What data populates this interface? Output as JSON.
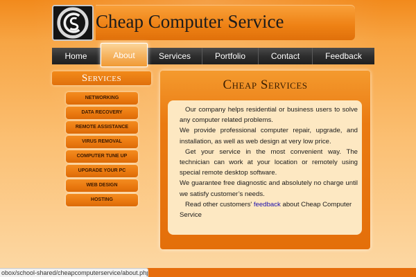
{
  "header": {
    "site_title": "Cheap Computer Service",
    "logo_text": "CS"
  },
  "nav": {
    "items": [
      {
        "label": "Home"
      },
      {
        "label": "About"
      },
      {
        "label": "Services"
      },
      {
        "label": "Portfolio"
      },
      {
        "label": "Contact"
      },
      {
        "label": "Feedback"
      }
    ],
    "active": "About"
  },
  "sidebar": {
    "title": "Services",
    "items": [
      {
        "label": "NETWORKING"
      },
      {
        "label": "DATA RECOVERY"
      },
      {
        "label": "REMOTE ASSISTANCE"
      },
      {
        "label": "VIRUS REMOVAL"
      },
      {
        "label": "COMPUTER TUNE UP"
      },
      {
        "label": "UPGRADE YOUR PC"
      },
      {
        "label": "WEB DESIGN"
      },
      {
        "label": "HOSTING"
      }
    ]
  },
  "main": {
    "title": "Cheap Services",
    "paragraphs": [
      "Our company helps residential or business users to solve any computer related problems.",
      "We provide professional computer repair, upgrade, and installation, as well as web design at very low price.",
      "Get your service in the most convenient way. The technician can work at your location or remotely using special remote desktop software.",
      "We guarantee free diagnostic and absolutely no charge until we satisfy customer’s needs."
    ],
    "last_paragraph": {
      "before": "Read other customers'",
      "link": "feedback",
      "after": "about Cheap Computer Service"
    }
  },
  "status_bar": {
    "url": "obox/school-shared/cheapcomputerservice/about.php"
  },
  "colors": {
    "accent": "#ee8114",
    "nav_bg": "#2e2e2e",
    "content_bg": "#fde8c2",
    "link": "#1a0dab"
  }
}
